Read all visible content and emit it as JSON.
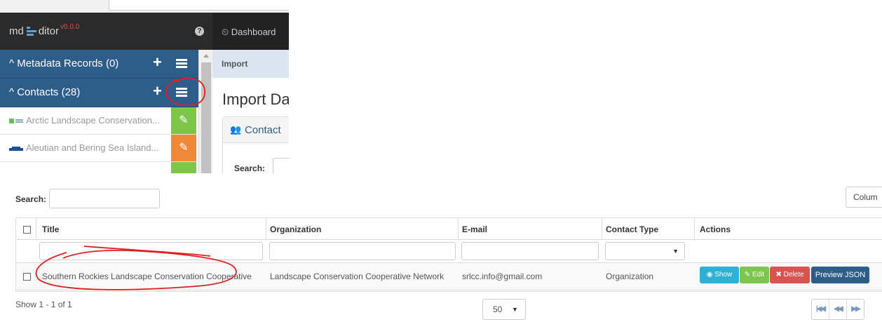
{
  "app": {
    "logo_prefix": "md",
    "logo_suffix": "ditor",
    "version": "v0.0.0",
    "help_glyph": "?"
  },
  "sidebar": {
    "sections": [
      {
        "label": "Metadata Records (0)",
        "chevron": "^",
        "add_glyph": "+"
      },
      {
        "label": "Contacts (28)",
        "chevron": "^",
        "add_glyph": "+"
      }
    ],
    "contacts": [
      {
        "label": "Arctic Landscape Conservation...",
        "edit_color": "#7dc64b"
      },
      {
        "label": "Aleutian and Bering Sea Island...",
        "edit_color": "#f0883a"
      },
      {
        "label": "",
        "edit_color": "#7dc64b"
      }
    ]
  },
  "navbar": {
    "dashboard_label": "Dashboard"
  },
  "breadcrumb": {
    "label": "Import"
  },
  "page": {
    "title": "Import Da",
    "panel_title": "Contact",
    "search_label": "Search:"
  },
  "table": {
    "search_label": "Search:",
    "columns_button": "Colum",
    "headers": [
      "Title",
      "Organization",
      "E-mail",
      "Contact Type",
      "Actions"
    ],
    "rows": [
      {
        "title": "Southern Rockies Landscape Conservation Cooperative",
        "organization": "Landscape Conservation Cooperative Network",
        "email": "srlcc.info@gmail.com",
        "contact_type": "Organization"
      }
    ],
    "actions": {
      "show": "Show",
      "edit": "Edit",
      "delete": "Delete",
      "preview": "Preview JSON"
    },
    "pagination_text": "Show 1 - 1 of 1",
    "page_size": "50",
    "pager_glyphs": [
      "|◀◀",
      "◀◀",
      "▶▶"
    ]
  },
  "colors": {
    "sidebar_section": "#2f5d8a",
    "header_dark": "#2b2b2b",
    "logo_accent": "#5aa1e3",
    "version_red": "#d9534f",
    "annotation_red": "#e02020"
  }
}
